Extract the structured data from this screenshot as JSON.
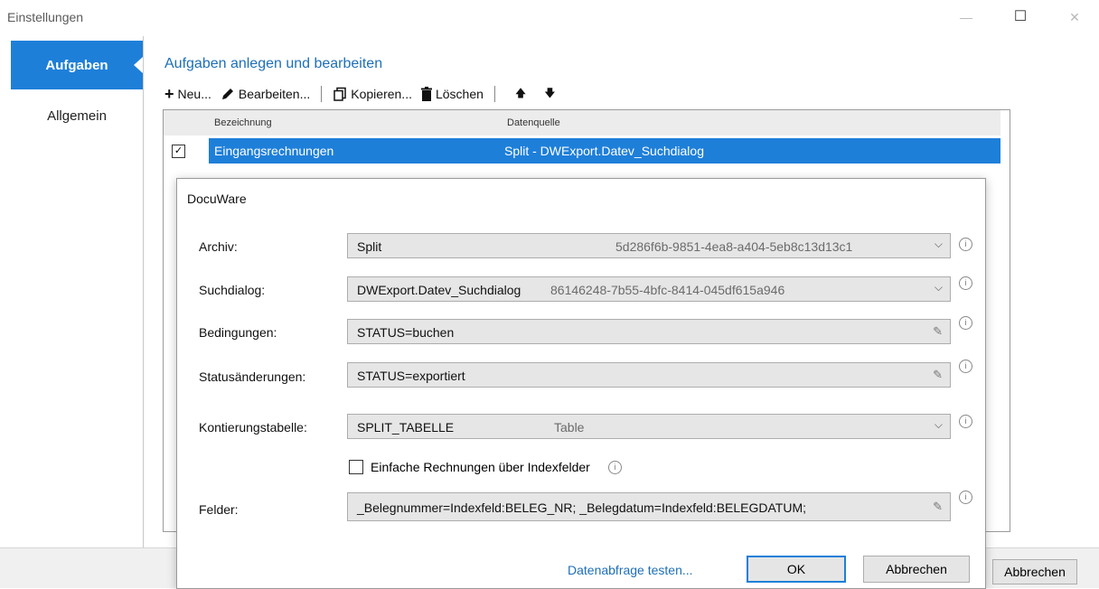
{
  "window": {
    "title": "Einstellungen",
    "minimize_glyph": "—",
    "maximize_glyph": "☐",
    "close_glyph": "✕"
  },
  "sidebar": {
    "items": [
      {
        "label": "Aufgaben",
        "active": true
      },
      {
        "label": "Allgemein",
        "active": false
      }
    ]
  },
  "main": {
    "title": "Aufgaben anlegen und bearbeiten",
    "toolbar": {
      "new_label": "Neu...",
      "edit_label": "Bearbeiten...",
      "copy_label": "Kopieren...",
      "delete_label": "Löschen",
      "up_glyph": "🡅",
      "down_glyph": "🡇"
    },
    "grid": {
      "columns": [
        "Bezeichnung",
        "Datenquelle"
      ],
      "rows": [
        {
          "checked": true,
          "name": "Eingangsrechnungen",
          "source": "Split - DWExport.Datev_Suchdialog"
        }
      ]
    }
  },
  "outer_cancel_label": "Abbrechen",
  "dialog": {
    "title": "DocuWare",
    "archiv": {
      "label": "Archiv:",
      "value": "Split",
      "id": "5d286f6b-9851-4ea8-a404-5eb8c13d13c1"
    },
    "suchdialog": {
      "label": "Suchdialog:",
      "value": "DWExport.Datev_Suchdialog",
      "id": "86146248-7b55-4bfc-8414-045df615a946"
    },
    "bedingungen": {
      "label": "Bedingungen:",
      "value": "STATUS=buchen"
    },
    "statusaenderungen": {
      "label": "Statusänderungen:",
      "value": "STATUS=exportiert"
    },
    "kontierung": {
      "label": "Kontierungstabelle:",
      "value": "SPLIT_TABELLE",
      "type": "Table"
    },
    "einfache": {
      "label": "Einfache Rechnungen über Indexfelder",
      "checked": false
    },
    "felder": {
      "label": "Felder:",
      "value": "_Belegnummer=Indexfeld:BELEG_NR; _Belegdatum=Indexfeld:BELEGDATUM;"
    },
    "test_link": "Datenabfrage testen...",
    "ok_label": "OK",
    "cancel_label": "Abbrechen",
    "info_glyph": "i",
    "chevron_glyph": "⌵",
    "pencil_glyph": "✎"
  },
  "colors": {
    "accent": "#1e7fd9",
    "title_blue": "#1e6fb8"
  }
}
